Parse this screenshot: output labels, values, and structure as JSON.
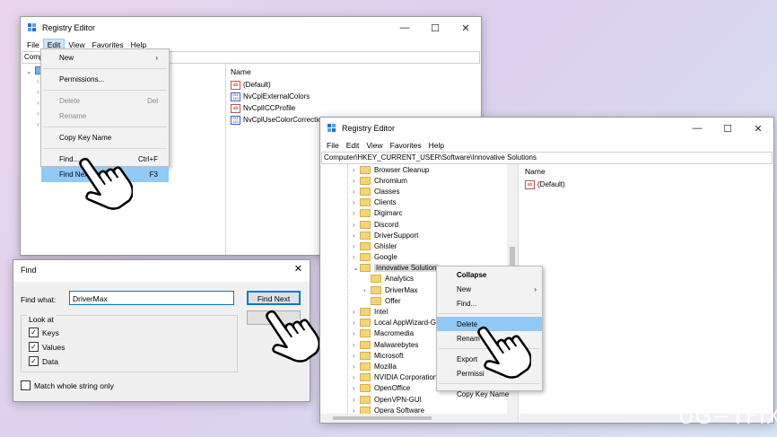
{
  "win1": {
    "title": "Registry Editor",
    "menu": [
      "File",
      "Edit",
      "View",
      "Favorites",
      "Help"
    ],
    "address": "Comp",
    "col_header": "Name",
    "values": [
      {
        "name": "(Default)",
        "type": "string"
      },
      {
        "name": "NvCplExternalColors",
        "type": "binary"
      },
      {
        "name": "NvCplICCProfile",
        "type": "string"
      },
      {
        "name": "NvCplUseColorCorrection",
        "type": "binary"
      }
    ]
  },
  "edit_menu": {
    "items": [
      {
        "label": "New",
        "shortcut": "",
        "disabled": false,
        "arrow": "›"
      },
      {
        "label": "Permissions...",
        "shortcut": "",
        "disabled": false
      },
      {
        "label": "Delete",
        "shortcut": "Del",
        "disabled": true
      },
      {
        "label": "Rename",
        "shortcut": "",
        "disabled": true
      },
      {
        "label": "Copy Key Name",
        "shortcut": "",
        "disabled": false
      },
      {
        "label": "Find...",
        "shortcut": "Ctrl+F",
        "disabled": false
      },
      {
        "label": "Find Next",
        "shortcut": "F3",
        "disabled": false,
        "highlight": true
      }
    ]
  },
  "find_dialog": {
    "title": "Find",
    "find_what_label": "Find what:",
    "find_what_value": "DriverMax",
    "find_next_label": "Find Next",
    "cancel_label": "C",
    "look_at_label": "Look at",
    "checks": [
      {
        "label": "Keys",
        "checked": true
      },
      {
        "label": "Values",
        "checked": true
      },
      {
        "label": "Data",
        "checked": true
      }
    ],
    "match_whole_label": "Match whole string only"
  },
  "win2": {
    "title": "Registry Editor",
    "menu": [
      "File",
      "Edit",
      "View",
      "Favorites",
      "Help"
    ],
    "address": "Computer\\HKEY_CURRENT_USER\\Software\\Innovative Solutions",
    "col_header": "Name",
    "default_value": "(Default)",
    "tree": [
      {
        "label": "Browser Cleanup",
        "indent": 0,
        "chev": true
      },
      {
        "label": "Chromium",
        "indent": 0,
        "chev": true
      },
      {
        "label": "Classes",
        "indent": 0,
        "chev": true
      },
      {
        "label": "Clients",
        "indent": 0,
        "chev": true
      },
      {
        "label": "Digimarc",
        "indent": 0,
        "chev": true
      },
      {
        "label": "Discord",
        "indent": 0,
        "chev": true
      },
      {
        "label": "DriverSupport",
        "indent": 0,
        "chev": true
      },
      {
        "label": "Ghisler",
        "indent": 0,
        "chev": true
      },
      {
        "label": "Google",
        "indent": 0,
        "chev": true
      },
      {
        "label": "Innovative Solution",
        "indent": 0,
        "chev": true,
        "open": true,
        "selected": true
      },
      {
        "label": "Analytics",
        "indent": 1,
        "chev": false
      },
      {
        "label": "DriverMax",
        "indent": 1,
        "chev": true
      },
      {
        "label": "Offer",
        "indent": 1,
        "chev": false
      },
      {
        "label": "Intel",
        "indent": 0,
        "chev": true
      },
      {
        "label": "Local AppWizard-G",
        "indent": 0,
        "chev": true
      },
      {
        "label": "Macromedia",
        "indent": 0,
        "chev": true
      },
      {
        "label": "Malwarebytes",
        "indent": 0,
        "chev": true
      },
      {
        "label": "Microsoft",
        "indent": 0,
        "chev": true
      },
      {
        "label": "Mozilla",
        "indent": 0,
        "chev": true
      },
      {
        "label": "NVIDIA Corporation",
        "indent": 0,
        "chev": true
      },
      {
        "label": "OpenOffice",
        "indent": 0,
        "chev": true
      },
      {
        "label": "OpenVPN-GUI",
        "indent": 0,
        "chev": true
      },
      {
        "label": "Opera Software",
        "indent": 0,
        "chev": true
      }
    ]
  },
  "context_menu": {
    "items": [
      {
        "label": "Collapse",
        "bold": true
      },
      {
        "label": "New",
        "arrow": "›"
      },
      {
        "label": "Find..."
      },
      {
        "label": "Delete",
        "highlight": true
      },
      {
        "label": "Renam"
      },
      {
        "label": "Export"
      },
      {
        "label": "Permissi"
      },
      {
        "label": "Copy Key Name"
      }
    ]
  },
  "watermark": "UG−TFIX",
  "colors": {
    "highlight": "#91c9f7",
    "folder": "#f5d477",
    "accent": "#0078d7"
  }
}
